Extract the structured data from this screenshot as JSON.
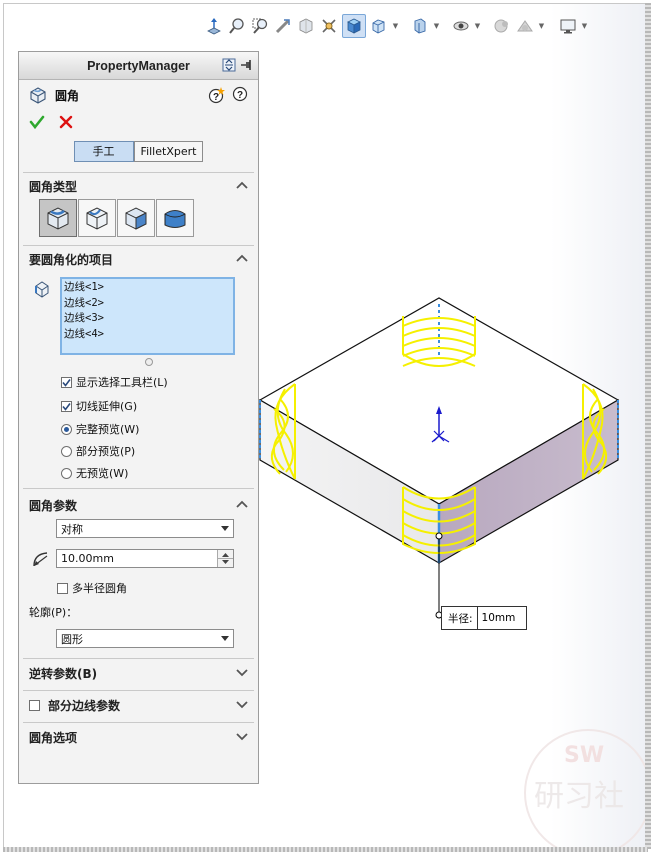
{
  "toolbar": {
    "icons": [
      "view-normal-icon",
      "zoom-fit-icon",
      "zoom-area-icon",
      "previous-view-icon",
      "section-view-icon",
      "dynamic-annotation-icon",
      "view-orientation-icon",
      "display-style-icon",
      "hide-show-icon",
      "edit-appearance-icon",
      "apply-scene-icon",
      "view-settings-icon"
    ]
  },
  "property_manager": {
    "title": "PropertyManager",
    "feature_name": "圆角",
    "mode_manual": "手工",
    "mode_filletxpert": "FilletXpert",
    "fillet_type": {
      "header": "圆角类型",
      "types": [
        "constant-size",
        "variable-size",
        "face-fillet",
        "full-round"
      ],
      "selected": 0
    },
    "items": {
      "header": "要圆角化的项目",
      "edges": [
        "边线<1>",
        "边线<2>",
        "边线<3>",
        "边线<4>"
      ],
      "show_selection_toolbar": "显示选择工具栏(L)",
      "tangent_propagation": "切线延伸(G)",
      "full_preview": "完整预览(W)",
      "partial_preview": "部分预览(P)",
      "no_preview": "无预览(W)"
    },
    "params": {
      "header": "圆角参数",
      "symmetry": "对称",
      "radius": "10.00mm",
      "multi_radius": "多半径圆角",
      "profile_label": "轮廓(P)：",
      "profile": "圆形"
    },
    "setback_header": "逆转参数(B)",
    "partial_edge_header": "部分边线参数",
    "options_header": "圆角选项"
  },
  "callout": {
    "label": "半径:",
    "value": "10mm"
  },
  "watermark": {
    "top": "SW",
    "middle": "研习社"
  },
  "colors": {
    "accent_blue": "#2b5a9c",
    "fillet_yellow": "#f5f000",
    "selected_list": "#cde6fb",
    "side_face_purple": "#bfb0c5"
  }
}
